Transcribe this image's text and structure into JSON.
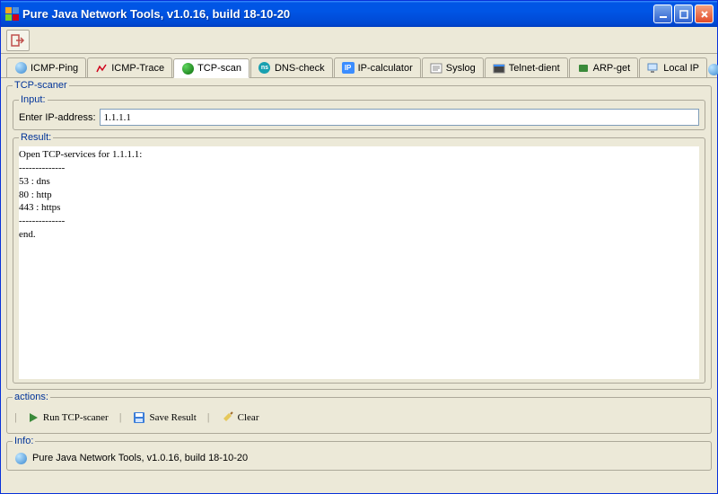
{
  "window": {
    "title": "Pure Java Network Tools,  v1.0.16, build 18-10-20"
  },
  "tabs": {
    "items": [
      {
        "label": "ICMP-Ping"
      },
      {
        "label": "ICMP-Trace"
      },
      {
        "label": "TCP-scan"
      },
      {
        "label": "DNS-check"
      },
      {
        "label": "IP-calculator"
      },
      {
        "label": "Syslog"
      },
      {
        "label": "Telnet-dient"
      },
      {
        "label": "ARP-get"
      },
      {
        "label": "Local IP"
      }
    ]
  },
  "scanner": {
    "legend": "TCP-scaner",
    "input_legend": "Input:",
    "input_label": "Enter IP-address:",
    "input_value": "1.1.1.1",
    "result_legend": "Result:",
    "result_text": "Open TCP-services for 1.1.1.1:\n--------------\n53 : dns\n80 : http\n443 : https\n--------------\nend."
  },
  "actions": {
    "legend": "actions:",
    "run": "Run TCP-scaner",
    "save": "Save Result",
    "clear": "Clear"
  },
  "info": {
    "legend": "Info:",
    "text": "Pure Java Network Tools,  v1.0.16, build 18-10-20"
  }
}
